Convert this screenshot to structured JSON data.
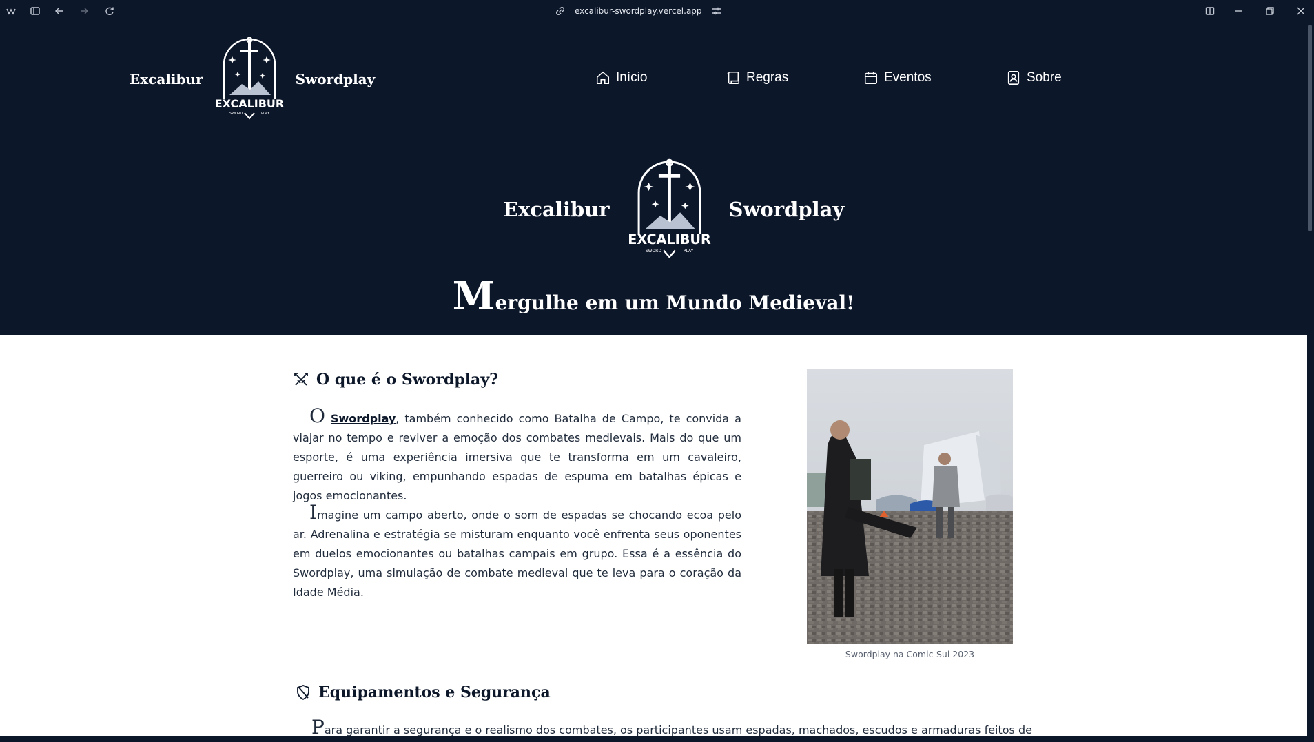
{
  "browser": {
    "url": "excalibur-swordplay.vercel.app",
    "icons": [
      "app-menu-icon",
      "sidebar-toggle-icon",
      "back-icon",
      "forward-icon",
      "reload-icon",
      "link-icon",
      "site-settings-icon",
      "split-view-icon",
      "minimize-icon",
      "maximize-icon",
      "close-icon"
    ]
  },
  "header": {
    "brand_left": "Excalibur",
    "brand_right": "Swordplay",
    "logo_text": "EXCALIBUR",
    "logo_sub_left": "SWORD",
    "logo_sub_right": "PLAY",
    "nav": [
      {
        "label": "Início",
        "icon": "home-icon"
      },
      {
        "label": "Regras",
        "icon": "scroll-icon"
      },
      {
        "label": "Eventos",
        "icon": "calendar-icon"
      },
      {
        "label": "Sobre",
        "icon": "contact-book-icon"
      }
    ]
  },
  "hero": {
    "brand_left": "Excalibur",
    "brand_right": "Swordplay",
    "title_initial": "M",
    "title_rest": "ergulhe em um Mundo Medieval!"
  },
  "section1": {
    "heading": "O que é o Swordplay?",
    "p1_initial": "O",
    "p1_link": "Swordplay",
    "p1_rest": ", também conhecido como Batalha de Campo, te convida a viajar no tempo e reviver a emoção dos combates medievais. Mais do que um esporte, é uma experiência imersiva que te transforma em um cavaleiro, guerreiro ou viking, empunhando espadas de espuma em batalhas épicas e jogos emocionantes.",
    "p2_initial": "I",
    "p2_rest": "magine um campo aberto, onde o som de espadas se chocando ecoa pelo ar. Adrenalina e estratégia se misturam enquanto você enfrenta seus oponentes em duelos emocionantes ou batalhas campais em grupo. Essa é a essência do Swordplay, uma simulação de combate medieval que te leva para o coração da Idade Média.",
    "photo_caption": "Swordplay na Comic-Sul 2023"
  },
  "section2": {
    "heading": "Equipamentos e Segurança",
    "p1_initial": "P",
    "p1_rest": "ara garantir a segurança e o realismo dos combates, os participantes usam espadas, machados, escudos e armaduras feitos de"
  },
  "colors": {
    "navy": "#0d172a",
    "white": "#ffffff",
    "text": "#1f2a3a"
  }
}
